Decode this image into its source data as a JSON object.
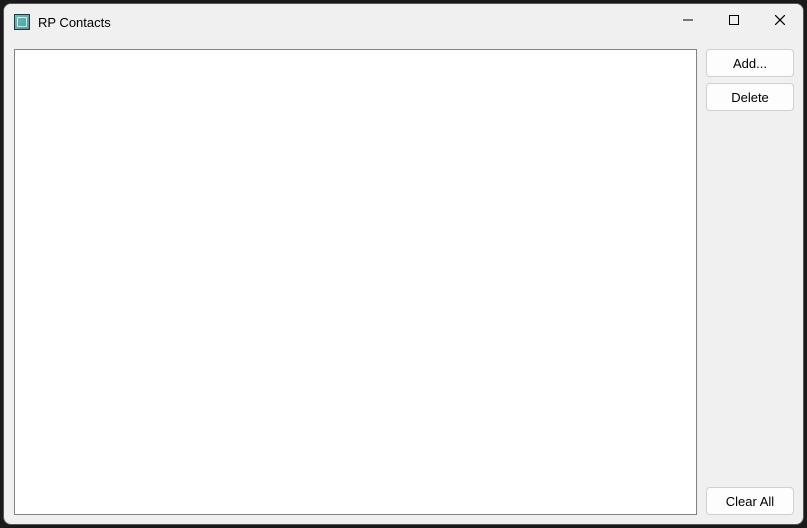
{
  "window": {
    "title": "RP Contacts"
  },
  "buttons": {
    "add": "Add...",
    "delete": "Delete",
    "clear_all": "Clear All"
  }
}
